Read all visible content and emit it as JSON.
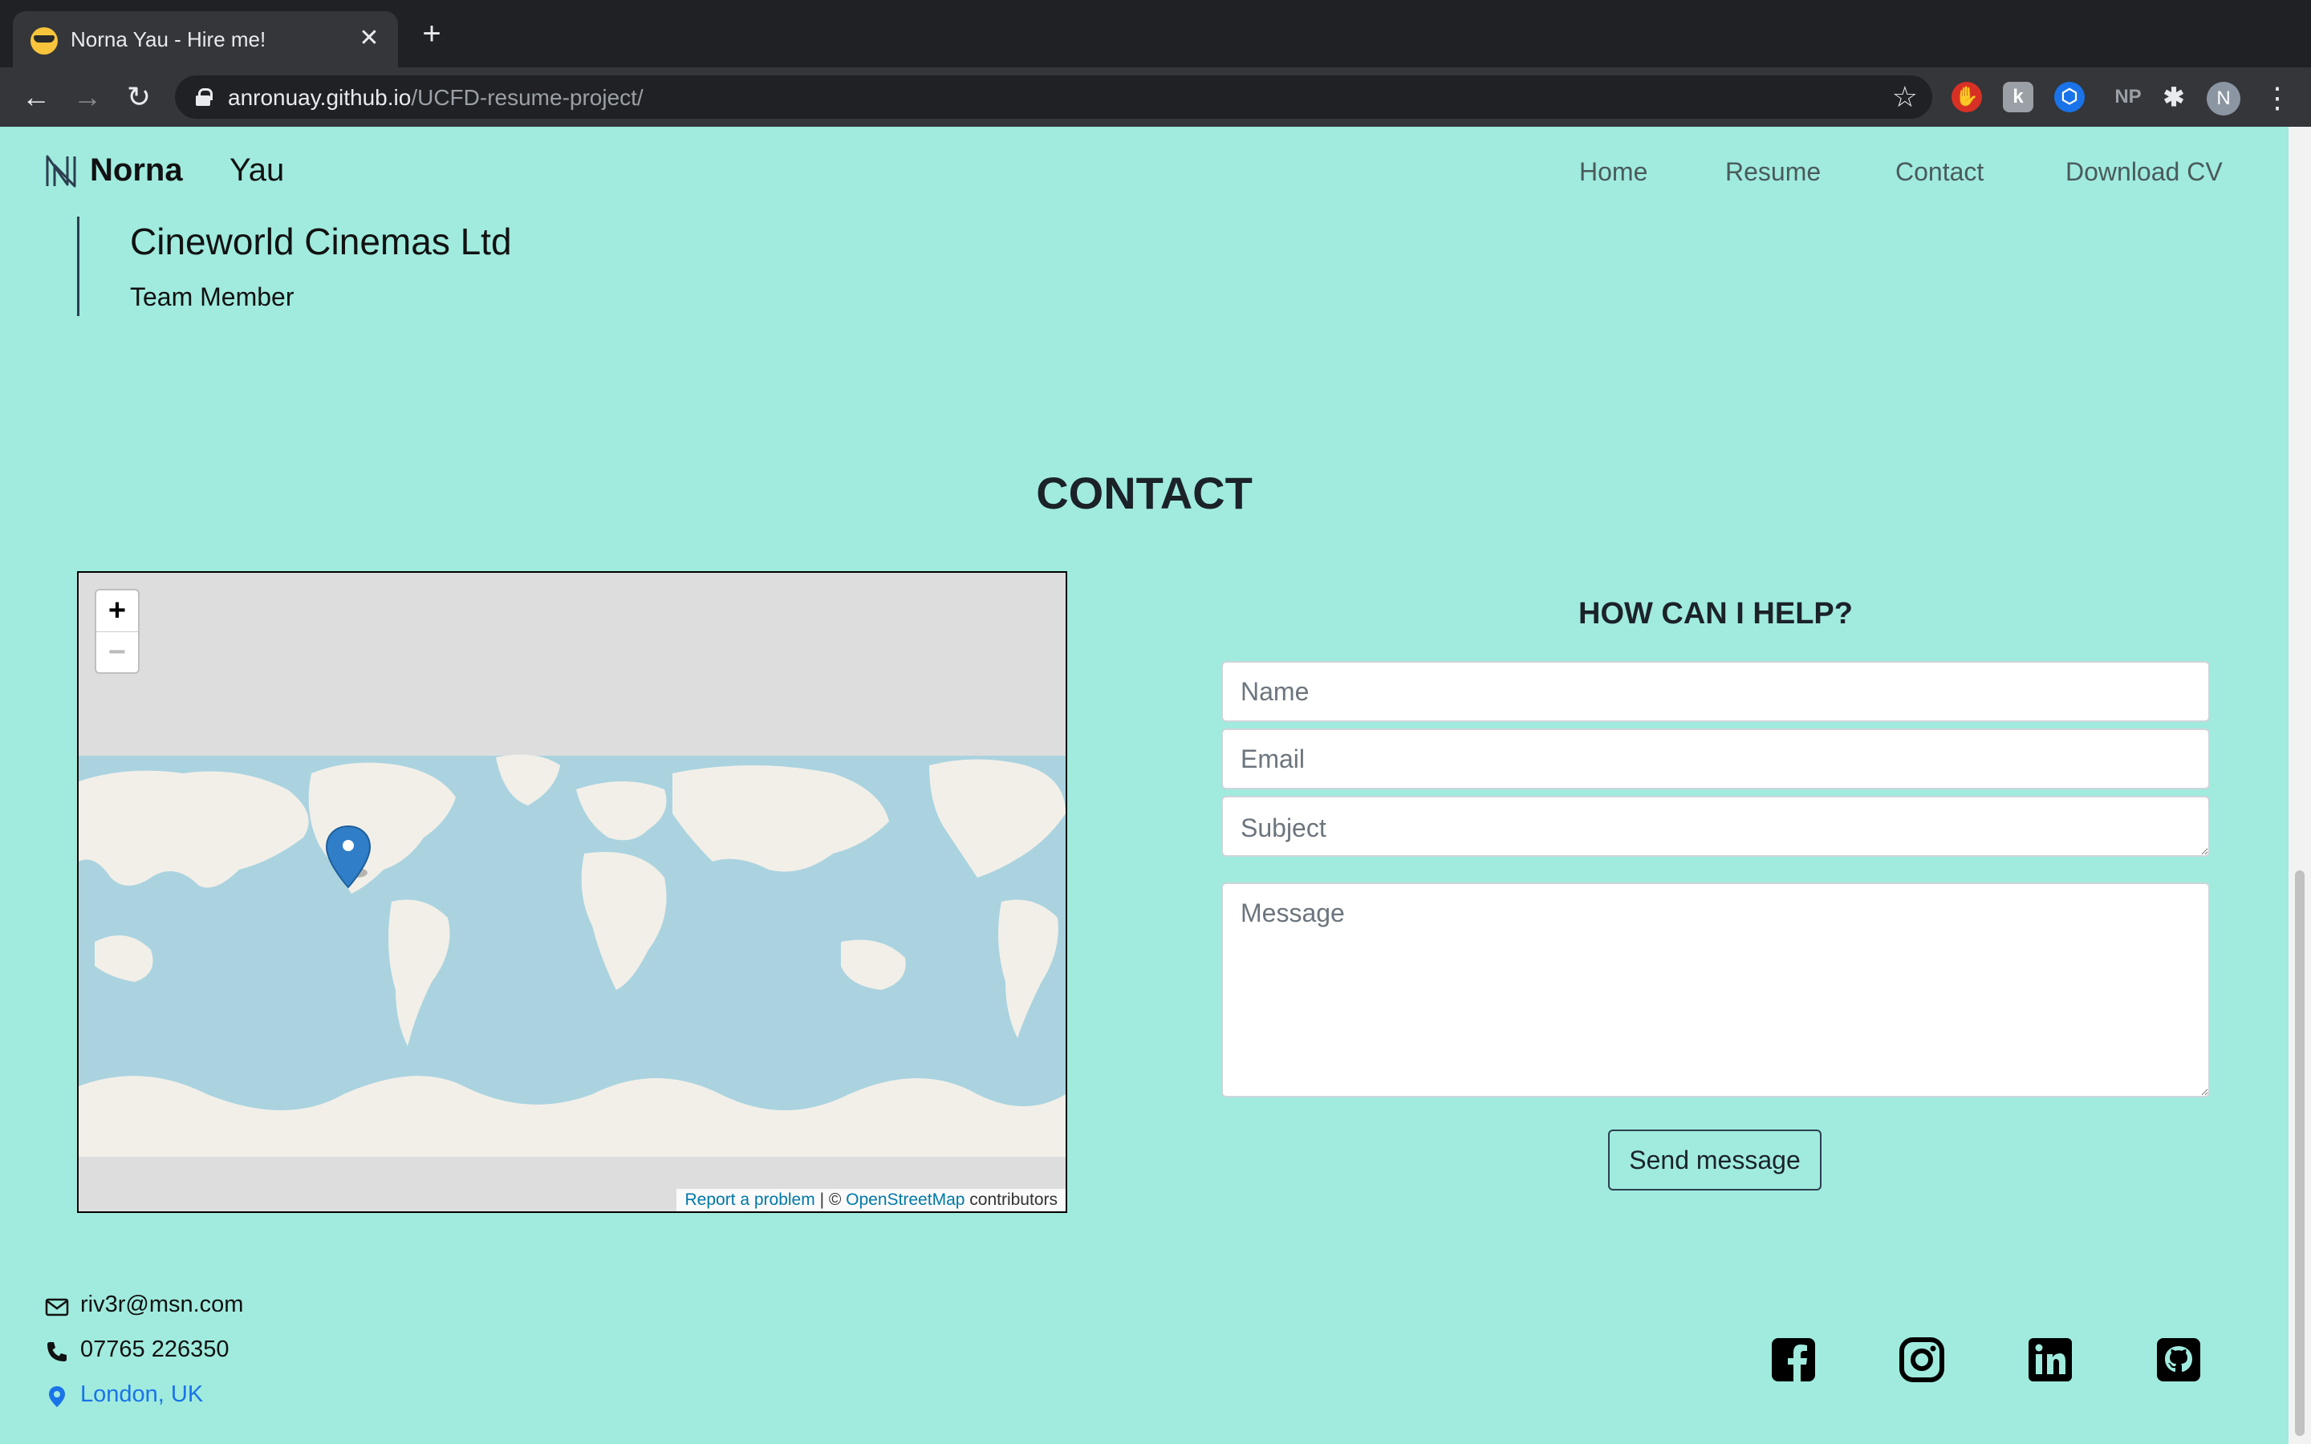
{
  "browser": {
    "tab_title": "Norna Yau - Hire me!",
    "url_host": "anronuay.github.io",
    "url_path": "/UCFD-resume-project/",
    "extension_np_label": "NP",
    "profile_initial": "N"
  },
  "site": {
    "brand_first": "Norna",
    "brand_last": "Yau",
    "nav": [
      "Home",
      "Resume",
      "Contact",
      "Download CV"
    ]
  },
  "experience": {
    "company": "Cineworld Cinemas Ltd",
    "role": "Team Member"
  },
  "contact": {
    "section_title": "CONTACT",
    "form_title": "HOW CAN I HELP?",
    "name_placeholder": "Name",
    "email_placeholder": "Email",
    "subject_placeholder": "Subject",
    "message_placeholder": "Message",
    "send_label": "Send message"
  },
  "map": {
    "zoom_in": "+",
    "zoom_out": "−",
    "report_link": "Report a problem",
    "separator": " | © ",
    "osm_link": "OpenStreetMap",
    "contributors": " contributors"
  },
  "footer": {
    "email": "riv3r@msn.com",
    "phone": "07765 226350",
    "location": "London, UK",
    "social": [
      "facebook-icon",
      "instagram-icon",
      "linkedin-icon",
      "github-icon"
    ]
  },
  "colors": {
    "page_bg": "#a0ebde",
    "map_marker": "#2f7ec7",
    "link": "#1a73e8"
  }
}
